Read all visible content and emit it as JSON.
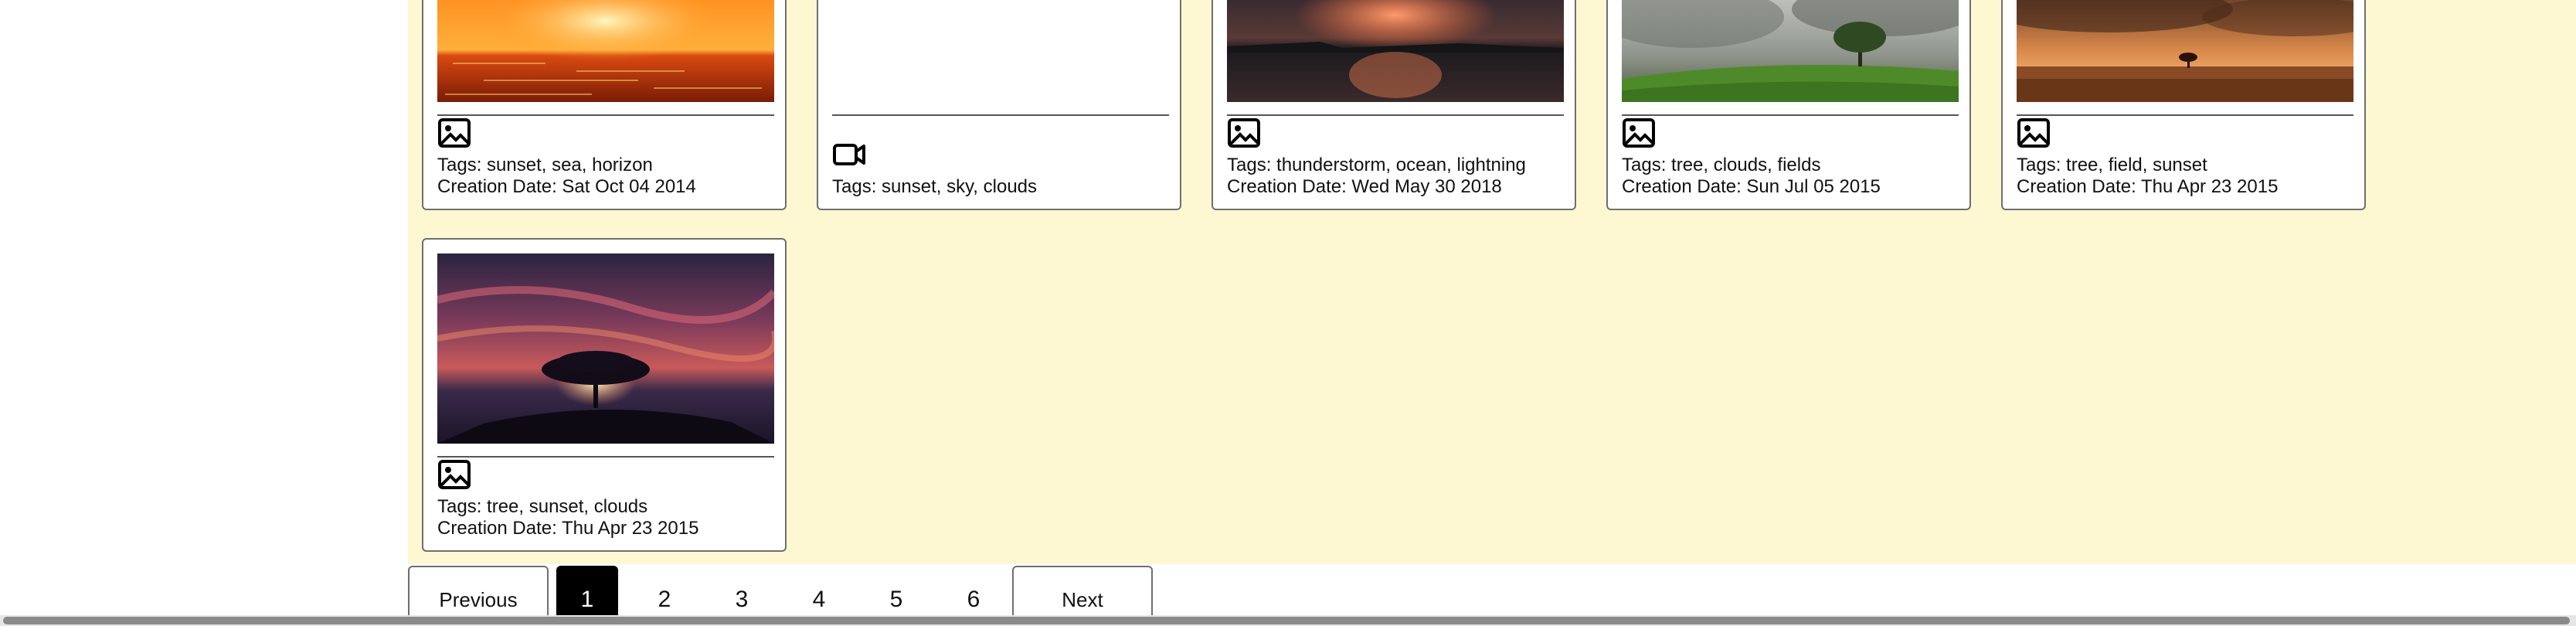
{
  "cards": [
    {
      "kind": "image",
      "icon": "image-icon",
      "tags": "Tags: sunset, sea, horizon",
      "date": "Creation Date: Sat Oct 04 2014"
    },
    {
      "kind": "video",
      "icon": "video-camera-icon",
      "tags": "Tags: sunset, sky, clouds"
    },
    {
      "kind": "image",
      "icon": "image-icon",
      "tags": "Tags: thunderstorm, ocean, lightning",
      "date": "Creation Date: Wed May 30 2018"
    },
    {
      "kind": "image",
      "icon": "image-icon",
      "tags": "Tags: tree, clouds, fields",
      "date": "Creation Date: Sun Jul 05 2015"
    },
    {
      "kind": "image",
      "icon": "image-icon",
      "tags": "Tags: tree, field, sunset",
      "date": "Creation Date: Thu Apr 23 2015"
    },
    {
      "kind": "image",
      "icon": "image-icon",
      "tags": "Tags: tree, sunset, clouds",
      "date": "Creation Date: Thu Apr 23 2015"
    }
  ],
  "pagination": {
    "previous_label": "Previous",
    "next_label": "Next",
    "pages": [
      "1",
      "2",
      "3",
      "4",
      "5",
      "6"
    ],
    "current_page": "1"
  },
  "colors": {
    "gallery_background": "#fdf8d2",
    "active_page": "#000000"
  }
}
